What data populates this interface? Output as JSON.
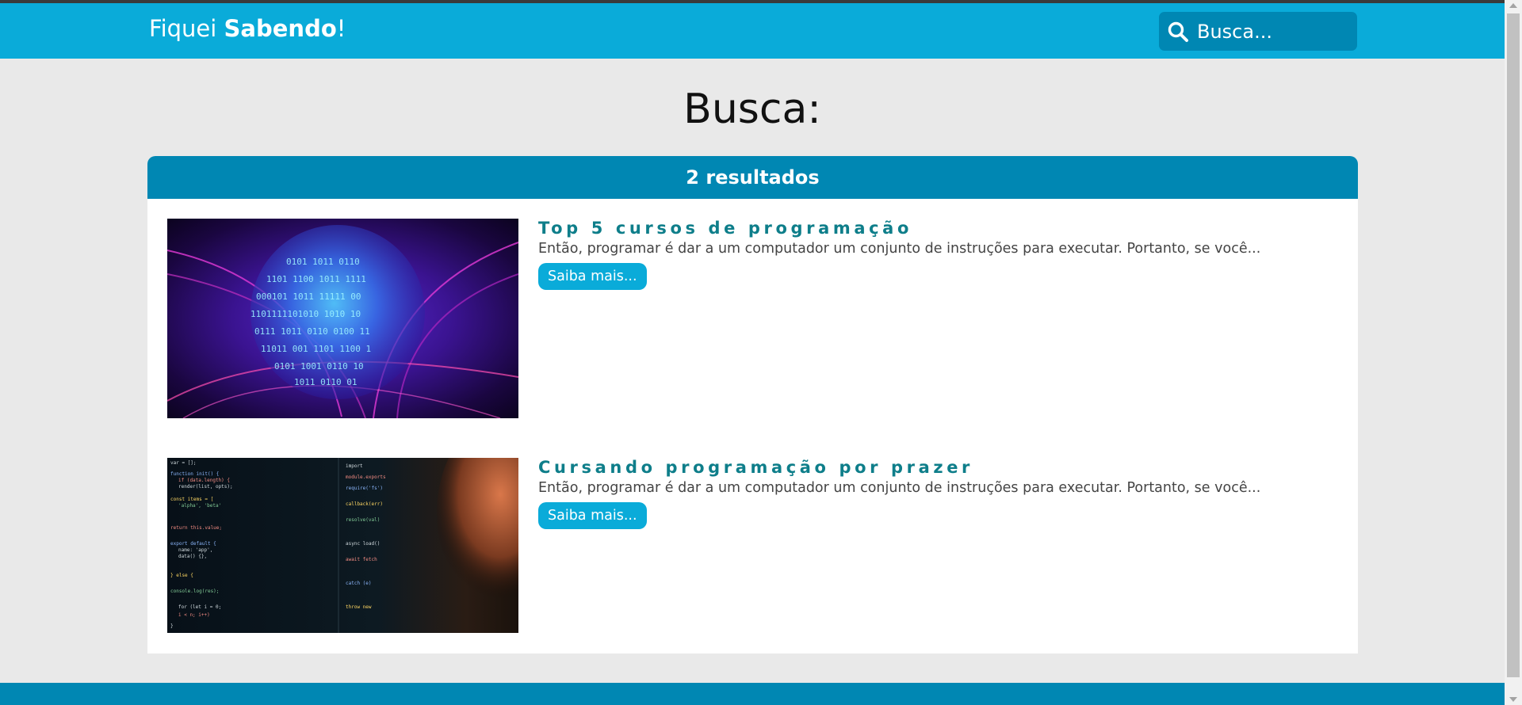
{
  "header": {
    "logo_light": "Fiquei ",
    "logo_bold": "Sabendo",
    "logo_end": "!",
    "search_placeholder": "Busca..."
  },
  "page": {
    "title": "Busca:"
  },
  "results": {
    "count_label": "2 resultados",
    "items": [
      {
        "title": "Top 5 cursos de programação",
        "description": "Então, programar é dar a um computador um conjunto de instruções para executar. Portanto, se você...",
        "button_label": "Saiba mais..."
      },
      {
        "title": "Cursando programação por prazer",
        "description": "Então, programar é dar a um computador um conjunto de instruções para executar. Portanto, se você...",
        "button_label": "Saiba mais..."
      }
    ]
  },
  "colors": {
    "header_bg": "#0aabd9",
    "accent_dark": "#0087b3",
    "title_color": "#0e7e8a",
    "page_bg": "#e9e9e9"
  },
  "icons": {
    "search": "search-icon"
  }
}
